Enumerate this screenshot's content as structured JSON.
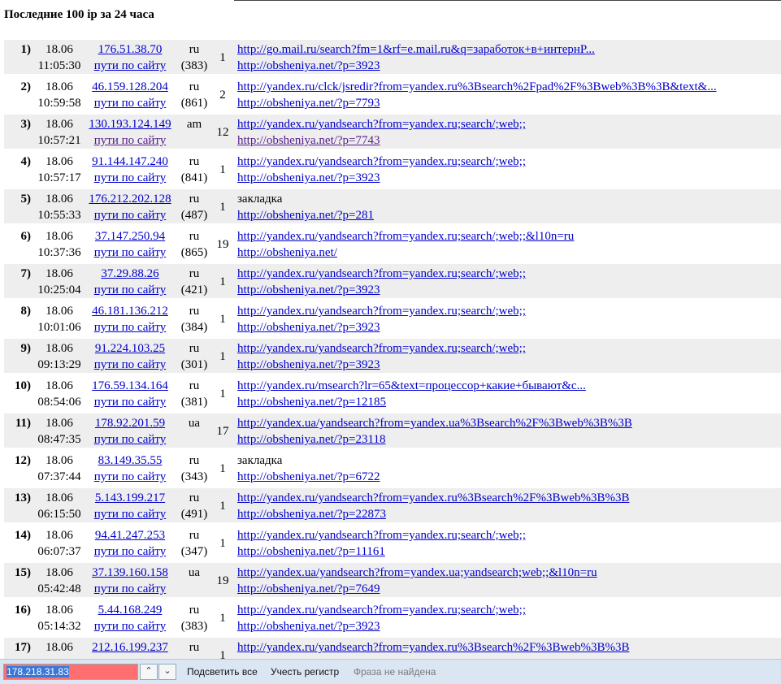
{
  "page_title": "Последние 100 ip за 24 часа",
  "rows": [
    {
      "num": "1)",
      "date": "18.06",
      "time": "11:05:30",
      "ip": "176.51.38.70",
      "paths": "пути по сайту",
      "cc": "ru",
      "count": "(383)",
      "visits": "1",
      "ref": "http://go.mail.ru/search?fm=1&rf=e.mail.ru&q=заработок+в+интернP...",
      "land": "http://obsheniya.net/?p=3923"
    },
    {
      "num": "2)",
      "date": "18.06",
      "time": "10:59:58",
      "ip": "46.159.128.204",
      "paths": "пути по сайту",
      "cc": "ru",
      "count": "(861)",
      "visits": "2",
      "ref": "http://yandex.ru/clck/jsredir?from=yandex.ru%3Bsearch%2Fpad%2F%3Bweb%3B%3B&text&...",
      "land": "http://obsheniya.net/?p=7793"
    },
    {
      "num": "3)",
      "date": "18.06",
      "time": "10:57:21",
      "ip": "130.193.124.149",
      "paths": "пути по сайту",
      "cc": "am",
      "count": "",
      "visits": "12",
      "ref": "http://yandex.ru/yandsearch?from=yandex.ru;search/;web;;",
      "land": "http://obsheniya.net/?p=7743"
    },
    {
      "num": "4)",
      "date": "18.06",
      "time": "10:57:17",
      "ip": "91.144.147.240",
      "paths": "пути по сайту",
      "cc": "ru",
      "count": "(841)",
      "visits": "1",
      "ref": "http://yandex.ru/yandsearch?from=yandex.ru;search/;web;;",
      "land": "http://obsheniya.net/?p=3923"
    },
    {
      "num": "5)",
      "date": "18.06",
      "time": "10:55:33",
      "ip": "176.212.202.128",
      "paths": "пути по сайту",
      "cc": "ru",
      "count": "(487)",
      "visits": "1",
      "ref": "закладка",
      "land": "http://obsheniya.net/?p=281"
    },
    {
      "num": "6)",
      "date": "18.06",
      "time": "10:37:36",
      "ip": "37.147.250.94",
      "paths": "пути по сайту",
      "cc": "ru",
      "count": "(865)",
      "visits": "19",
      "ref": "http://yandex.ru/yandsearch?from=yandex.ru;search/;web;;&l10n=ru",
      "land": "http://obsheniya.net/"
    },
    {
      "num": "7)",
      "date": "18.06",
      "time": "10:25:04",
      "ip": "37.29.88.26",
      "paths": "пути по сайту",
      "cc": "ru",
      "count": "(421)",
      "visits": "1",
      "ref": "http://yandex.ru/yandsearch?from=yandex.ru;search/;web;;",
      "land": "http://obsheniya.net/?p=3923"
    },
    {
      "num": "8)",
      "date": "18.06",
      "time": "10:01:06",
      "ip": "46.181.136.212",
      "paths": "пути по сайту",
      "cc": "ru",
      "count": "(384)",
      "visits": "1",
      "ref": "http://yandex.ru/yandsearch?from=yandex.ru;search/;web;;",
      "land": "http://obsheniya.net/?p=3923"
    },
    {
      "num": "9)",
      "date": "18.06",
      "time": "09:13:29",
      "ip": "91.224.103.25",
      "paths": "пути по сайту",
      "cc": "ru",
      "count": "(301)",
      "visits": "1",
      "ref": "http://yandex.ru/yandsearch?from=yandex.ru;search/;web;;",
      "land": "http://obsheniya.net/?p=3923"
    },
    {
      "num": "10)",
      "date": "18.06",
      "time": "08:54:06",
      "ip": "176.59.134.164",
      "paths": "пути по сайту",
      "cc": "ru",
      "count": "(381)",
      "visits": "1",
      "ref": "http://yandex.ru/msearch?lr=65&text=процессор+какие+бывают&c...",
      "land": "http://obsheniya.net/?p=12185"
    },
    {
      "num": "11)",
      "date": "18.06",
      "time": "08:47:35",
      "ip": "178.92.201.59",
      "paths": "пути по сайту",
      "cc": "ua",
      "count": "",
      "visits": "17",
      "ref": "http://yandex.ua/yandsearch?from=yandex.ua%3Bsearch%2F%3Bweb%3B%3B",
      "land": "http://obsheniya.net/?p=23118"
    },
    {
      "num": "12)",
      "date": "18.06",
      "time": "07:37:44",
      "ip": "83.149.35.55",
      "paths": "пути по сайту",
      "cc": "ru",
      "count": "(343)",
      "visits": "1",
      "ref": "закладка",
      "land": "http://obsheniya.net/?p=6722"
    },
    {
      "num": "13)",
      "date": "18.06",
      "time": "06:15:50",
      "ip": "5.143.199.217",
      "paths": "пути по сайту",
      "cc": "ru",
      "count": "(491)",
      "visits": "1",
      "ref": "http://yandex.ru/yandsearch?from=yandex.ru%3Bsearch%2F%3Bweb%3B%3B",
      "land": "http://obsheniya.net/?p=22873"
    },
    {
      "num": "14)",
      "date": "18.06",
      "time": "06:07:37",
      "ip": "94.41.247.253",
      "paths": "пути по сайту",
      "cc": "ru",
      "count": "(347)",
      "visits": "1",
      "ref": "http://yandex.ru/yandsearch?from=yandex.ru;search/;web;;",
      "land": "http://obsheniya.net/?p=11161"
    },
    {
      "num": "15)",
      "date": "18.06",
      "time": "05:42:48",
      "ip": "37.139.160.158",
      "paths": "пути по сайту",
      "cc": "ua",
      "count": "",
      "visits": "19",
      "ref": "http://yandex.ua/yandsearch?from=yandex.ua;yandsearch;web;;&l10n=ru",
      "land": "http://obsheniya.net/?p=7649"
    },
    {
      "num": "16)",
      "date": "18.06",
      "time": "05:14:32",
      "ip": "5.44.168.249",
      "paths": "пути по сайту",
      "cc": "ru",
      "count": "(383)",
      "visits": "1",
      "ref": "http://yandex.ru/yandsearch?from=yandex.ru;search/;web;;",
      "land": "http://obsheniya.net/?p=3923"
    },
    {
      "num": "17)",
      "date": "18.06",
      "time": "",
      "ip": "212.16.199.237",
      "paths": "",
      "cc": "ru",
      "count": "",
      "visits": "1",
      "ref": "http://yandex.ru/yandsearch?from=yandex.ru%3Bsearch%2F%3Bweb%3B%3B",
      "land": ""
    }
  ],
  "findbar": {
    "query": "178.218.31.83",
    "prev_icon": "chevron-up-icon",
    "next_icon": "chevron-down-icon",
    "prev_glyph": "⌃",
    "next_glyph": "⌄",
    "highlight_all": "Подсветить все",
    "match_case": "Учесть регистр",
    "status": "Фраза не найдена"
  },
  "colors": {
    "link": "#0000cc",
    "visited_link": "#551a8b",
    "row_shade": "#eeeeee",
    "find_not_found": "#ff6f6f",
    "findbar_bg": "#dbe6f3"
  }
}
